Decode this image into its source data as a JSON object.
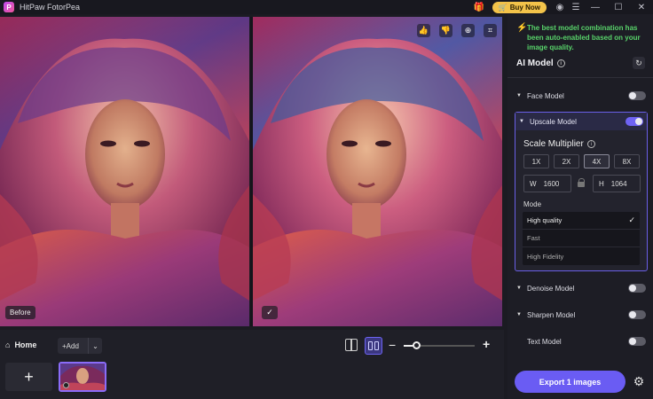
{
  "app": {
    "title": "HitPaw FotorPea",
    "logo_letter": "P",
    "buy_label": "Buy Now"
  },
  "preview": {
    "before_label": "Before"
  },
  "bottom": {
    "home_label": "Home",
    "add_label": "Add",
    "zoom_level": 0.18
  },
  "panel": {
    "notice": "The best model combination has been auto-enabled based on your image quality.",
    "section_title": "AI Model",
    "models": {
      "face": {
        "label": "Face Model",
        "enabled": false
      },
      "upscale": {
        "label": "Upscale Model",
        "enabled": true
      },
      "denoise": {
        "label": "Denoise Model",
        "enabled": false
      },
      "sharpen": {
        "label": "Sharpen Model",
        "enabled": false
      },
      "text": {
        "label": "Text Model",
        "enabled": false
      }
    },
    "scale": {
      "title": "Scale Multiplier",
      "options": [
        "1X",
        "2X",
        "4X",
        "8X"
      ],
      "selected": "4X",
      "width_label": "W",
      "width_value": "1600",
      "height_label": "H",
      "height_value": "1064"
    },
    "mode": {
      "label": "Mode",
      "options": [
        "High quality",
        "Fast",
        "High Fidelity"
      ],
      "selected": "High quality"
    },
    "export_label": "Export 1 images"
  },
  "colors": {
    "accent": "#6a5cf3",
    "notice_green": "#58d36a",
    "buy_yellow": "#f3c34a"
  }
}
